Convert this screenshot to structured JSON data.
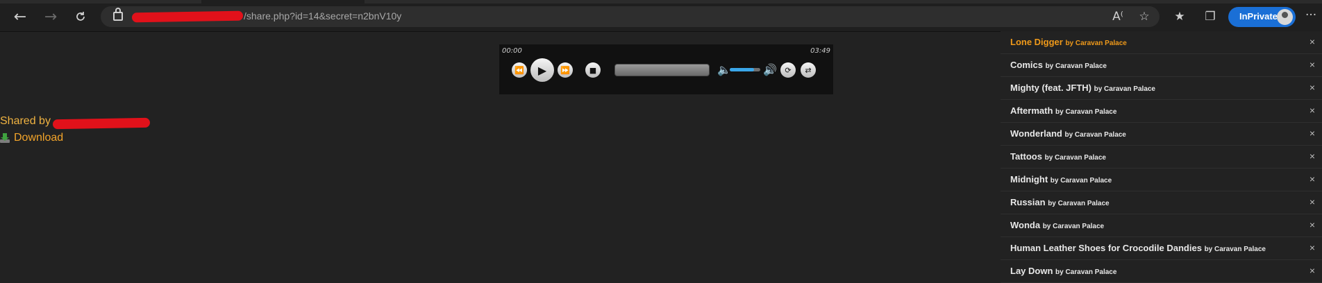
{
  "browser": {
    "url_visible": "/share.php?id=14&secret=n2bnV10y",
    "inprivate_label": "InPrivate"
  },
  "player": {
    "current_time": "00:00",
    "duration": "03:49",
    "progress": 0,
    "volume": 0.8
  },
  "share": {
    "shared_by_label": "Shared by",
    "download_label": "Download"
  },
  "playlist": [
    {
      "title": "Lone Digger",
      "artist": "by Caravan Palace",
      "active": true
    },
    {
      "title": "Comics",
      "artist": "by Caravan Palace"
    },
    {
      "title": "Mighty (feat. JFTH)",
      "artist": "by Caravan Palace"
    },
    {
      "title": "Aftermath",
      "artist": "by Caravan Palace"
    },
    {
      "title": "Wonderland",
      "artist": "by Caravan Palace"
    },
    {
      "title": "Tattoos",
      "artist": "by Caravan Palace"
    },
    {
      "title": "Midnight",
      "artist": "by Caravan Palace"
    },
    {
      "title": "Russian",
      "artist": "by Caravan Palace"
    },
    {
      "title": "Wonda",
      "artist": "by Caravan Palace"
    },
    {
      "title": "Human Leather Shoes for Crocodile Dandies",
      "artist": "by Caravan Palace"
    },
    {
      "title": "Lay Down",
      "artist": "by Caravan Palace"
    }
  ],
  "icons": {
    "back": "arrow-left-icon",
    "forward": "arrow-right-icon",
    "refresh": "refresh-icon",
    "lock": "lock-icon",
    "read_aloud": "read-aloud-icon",
    "add_favorite": "add-favorite-icon",
    "favorites": "favorites-icon",
    "collections": "collections-icon",
    "more": "more-icon",
    "remove": "close-icon"
  },
  "colors": {
    "background": "#222222",
    "accent_orange": "#f09a1a",
    "shared_by": "#f0b341",
    "inprivate_blue": "#1a6fd6",
    "volume_blue": "#3aa6e9",
    "redaction": "#e1111a"
  }
}
